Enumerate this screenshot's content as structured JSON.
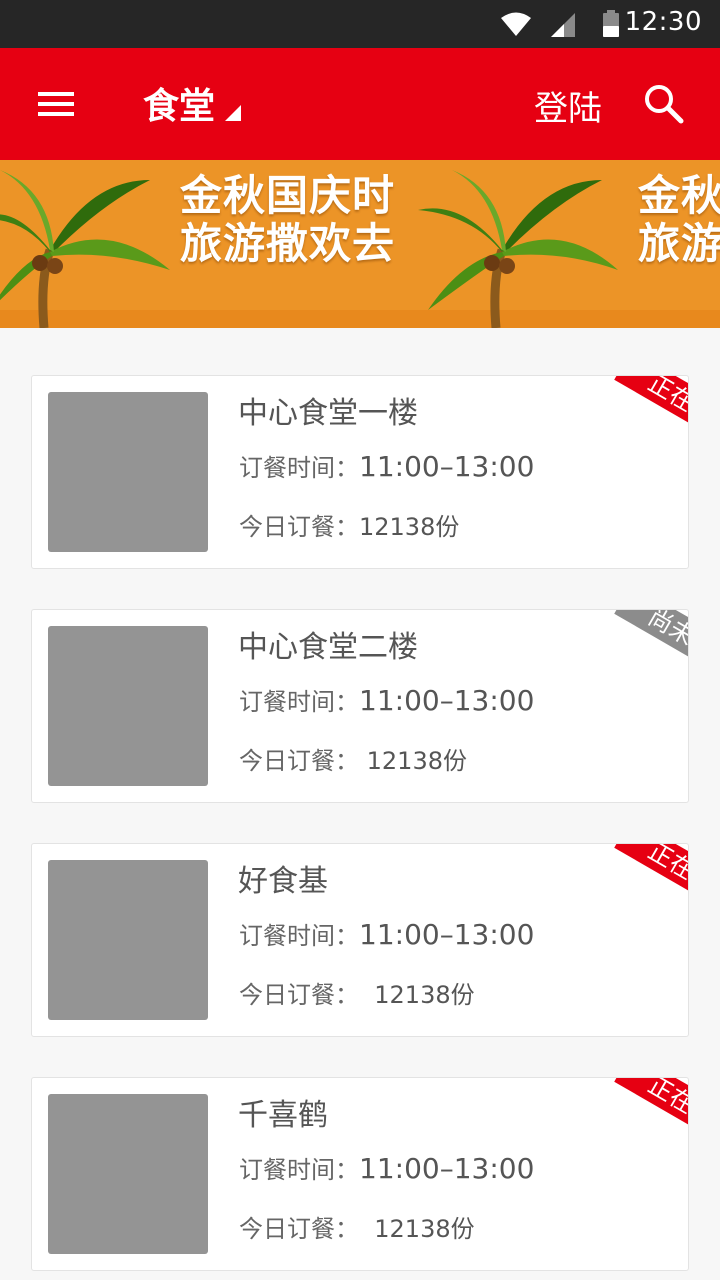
{
  "status_bar": {
    "time": "12:30",
    "icons": [
      "wifi-icon",
      "signal-icon",
      "battery-icon"
    ]
  },
  "app_bar": {
    "title": "食堂",
    "login_label": "登陆",
    "icons": [
      "menu-icon",
      "caret-down-icon",
      "search-icon"
    ]
  },
  "banner": {
    "line1": "金秋国庆时",
    "line2": "旅游撒欢去",
    "line1_partial": "金秋",
    "line2_partial": "旅游"
  },
  "canteens": [
    {
      "name": "中心食堂一楼",
      "time_label": "订餐时间：",
      "time": "11:00–13:00",
      "count_label": "今日订餐：",
      "count": "12138份",
      "status": "正在营业"
    },
    {
      "name": "中心食堂二楼",
      "time_label": "订餐时间：",
      "time": "11:00–13:00",
      "count_label": "今日订餐：",
      "count": " 12138份",
      "status": "尚未营业"
    },
    {
      "name": "好食基",
      "time_label": "订餐时间：",
      "time": "11:00–13:00",
      "count_label": "今日订餐：",
      "count": "  12138份",
      "status": "正在营业"
    },
    {
      "name": "千喜鹤",
      "time_label": "订餐时间：",
      "time": "11:00–13:00",
      "count_label": "今日订餐：",
      "count": "  12138份",
      "status": "正在营业"
    }
  ],
  "colors": {
    "primary": "#e60012",
    "banner_bg": "#ec9427",
    "closed_ribbon": "#8c8c8c",
    "thumb": "#949494"
  }
}
